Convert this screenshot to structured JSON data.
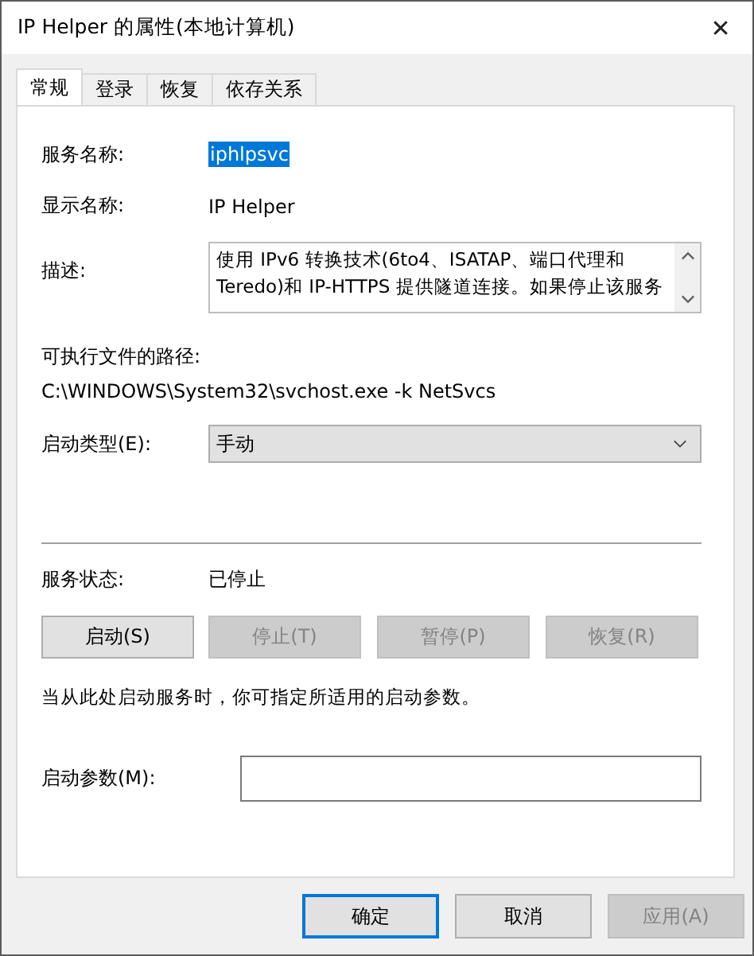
{
  "window": {
    "title": "IP Helper 的属性(本地计算机)",
    "close": "✕"
  },
  "tabs": [
    {
      "label": "常规",
      "selected": true
    },
    {
      "label": "登录",
      "selected": false
    },
    {
      "label": "恢复",
      "selected": false
    },
    {
      "label": "依存关系",
      "selected": false
    }
  ],
  "service_name": {
    "label": "服务名称:",
    "value": "iphlpsvc",
    "selected": true
  },
  "display_name": {
    "label": "显示名称:",
    "value": "IP Helper"
  },
  "description": {
    "label": "描述:",
    "value": "使用 IPv6 转换技术(6to4、ISATAP、端口代理和 Teredo)和 IP-HTTPS 提供隧道连接。如果停止该服务"
  },
  "path": {
    "label": "可执行文件的路径:",
    "value": "C:\\WINDOWS\\System32\\svchost.exe -k NetSvcs"
  },
  "startup_type": {
    "label": "启动类型(E):",
    "value": "手动"
  },
  "status": {
    "label": "服务状态:",
    "value": "已停止"
  },
  "service_buttons": [
    {
      "label": "启动(S)",
      "disabled": false
    },
    {
      "label": "停止(T)",
      "disabled": true
    },
    {
      "label": "暂停(P)",
      "disabled": true
    },
    {
      "label": "恢复(R)",
      "disabled": true
    }
  ],
  "hint": "当从此处启动服务时，你可指定所适用的启动参数。",
  "parameters": {
    "label": "启动参数(M):"
  },
  "dialog_buttons": [
    {
      "label": "确定",
      "default": true,
      "disabled": false
    },
    {
      "label": "取消",
      "default": false,
      "disabled": false
    },
    {
      "label": "应用(A)",
      "default": false,
      "disabled": true
    }
  ]
}
